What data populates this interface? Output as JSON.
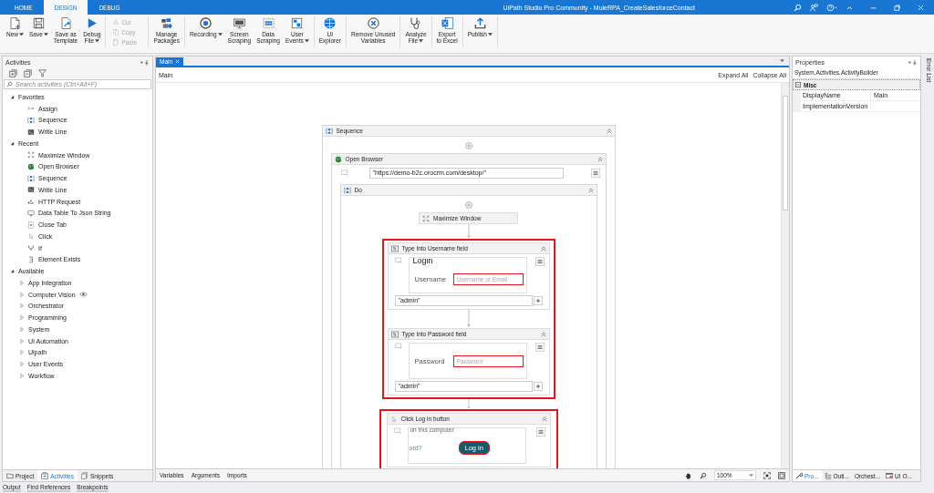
{
  "window": {
    "title": "UiPath Studio Pro Community - MuleRPA_CreateSalesforceContact"
  },
  "ribbon_tabs": [
    {
      "label": "HOME",
      "selected": false
    },
    {
      "label": "DESIGN",
      "selected": true
    },
    {
      "label": "DEBUG",
      "selected": false
    }
  ],
  "ribbon_groups": [
    {
      "kind": "large",
      "buttons": [
        {
          "label": "New",
          "dropdown": true
        },
        {
          "label": "Save",
          "dropdown": true
        },
        {
          "label": "Save as\nTemplate",
          "dropdown": false
        },
        {
          "label": "Debug\nFile",
          "dropdown": true
        }
      ]
    },
    {
      "kind": "small",
      "buttons": [
        {
          "label": "Cut",
          "disabled": true
        },
        {
          "label": "Copy",
          "disabled": true
        },
        {
          "label": "Paste",
          "disabled": true
        }
      ]
    },
    {
      "kind": "large",
      "buttons": [
        {
          "label": "Manage\nPackages",
          "dropdown": false
        }
      ]
    },
    {
      "kind": "large",
      "buttons": [
        {
          "label": "Recording",
          "dropdown": true
        },
        {
          "label": "Screen\nScraping",
          "dropdown": false
        },
        {
          "label": "Data\nScraping",
          "dropdown": false
        },
        {
          "label": "User\nEvents",
          "dropdown": true
        }
      ]
    },
    {
      "kind": "large",
      "buttons": [
        {
          "label": "UI\nExplorer",
          "dropdown": false
        }
      ]
    },
    {
      "kind": "large",
      "buttons": [
        {
          "label": "Remove Unused\nVariables",
          "dropdown": false
        }
      ]
    },
    {
      "kind": "large",
      "buttons": [
        {
          "label": "Analyze\nFile",
          "dropdown": true
        }
      ]
    },
    {
      "kind": "large",
      "buttons": [
        {
          "label": "Export\nto Excel",
          "dropdown": false
        }
      ]
    },
    {
      "kind": "large",
      "buttons": [
        {
          "label": "Publish",
          "dropdown": true
        }
      ]
    }
  ],
  "activities_panel": {
    "title": "Activities",
    "search": {
      "placeholder": "Search activities (Ctrl+Alt+F)"
    },
    "tree": [
      {
        "label": "Favorites",
        "expanded": true,
        "children": [
          {
            "label": "Assign"
          },
          {
            "label": "Sequence"
          },
          {
            "label": "Write Line"
          }
        ]
      },
      {
        "label": "Recent",
        "expanded": true,
        "children": [
          {
            "label": "Maximize Window"
          },
          {
            "label": "Open Browser"
          },
          {
            "label": "Sequence"
          },
          {
            "label": "Write Line"
          },
          {
            "label": "HTTP Request"
          },
          {
            "label": "Data Table To Json String"
          },
          {
            "label": "Close Tab"
          },
          {
            "label": "Click"
          },
          {
            "label": "If"
          },
          {
            "label": "Element Exists"
          }
        ]
      },
      {
        "label": "Available",
        "expanded": true,
        "children": [
          {
            "label": "App Integration",
            "expanded": false
          },
          {
            "label": "Computer Vision",
            "expanded": false
          },
          {
            "label": "Orchestrator",
            "expanded": false
          },
          {
            "label": "Programming",
            "expanded": false
          },
          {
            "label": "System",
            "expanded": false
          },
          {
            "label": "UI Automation",
            "expanded": false
          },
          {
            "label": "Uipath",
            "expanded": false
          },
          {
            "label": "User Events",
            "expanded": false
          },
          {
            "label": "Workflow",
            "expanded": false
          }
        ]
      }
    ],
    "tabs": [
      {
        "label": "Project",
        "selected": false
      },
      {
        "label": "Activities",
        "selected": true
      },
      {
        "label": "Snippets",
        "selected": false
      }
    ]
  },
  "document_tabs": [
    {
      "label": "Main",
      "selected": true
    }
  ],
  "breadcrumb": "Main",
  "expand_all": "Expand All",
  "collapse_all": "Collapse All",
  "workflow": {
    "title": "Sequence",
    "open_browser": {
      "title": "Open Browser",
      "url": "\"https://demo-b2c.orocrm.com/desktop/\"",
      "body": {
        "title": "Do",
        "steps": [
          {
            "kind": "activity",
            "title": "Maximize Window"
          },
          {
            "kind": "highlight",
            "children": [
              {
                "kind": "type-into",
                "title": "Type Into Username field",
                "screenshot": {
                  "heading": "Login",
                  "label": "Username",
                  "placeholder": "Username or Email"
                },
                "text": "\"admin\""
              },
              {
                "kind": "type-into",
                "title": "Type Into Password field",
                "screenshot": {
                  "label": "Password",
                  "placeholder": "Password"
                },
                "text": "\"admin\""
              }
            ]
          },
          {
            "kind": "highlight",
            "children": [
              {
                "kind": "click",
                "title": "Click Log in button",
                "screenshot": {
                  "caption": "on this computer",
                  "link": "ord?",
                  "button": "Log in"
                }
              }
            ]
          }
        ]
      }
    }
  },
  "designer_bar": {
    "tabs": [
      "Variables",
      "Arguments",
      "Imports"
    ],
    "zoom": "100%"
  },
  "properties": {
    "title": "Properties",
    "type": "System.Activities.ActivityBuilder",
    "category": {
      "label": "Misc",
      "expanded": true
    },
    "rows": [
      {
        "name": "DisplayName",
        "value": "Main"
      },
      {
        "name": "ImplementationVersion"
      }
    ],
    "tabs": [
      {
        "label": "Pro...",
        "selected": true
      },
      {
        "label": "Outl...",
        "selected": false
      },
      {
        "label": "Orchest...",
        "selected": false
      },
      {
        "label": "UI O...",
        "selected": false
      }
    ]
  },
  "side_strip": "Error List",
  "output_tabs": [
    "Output",
    "Find References",
    "Breakpoints"
  ]
}
